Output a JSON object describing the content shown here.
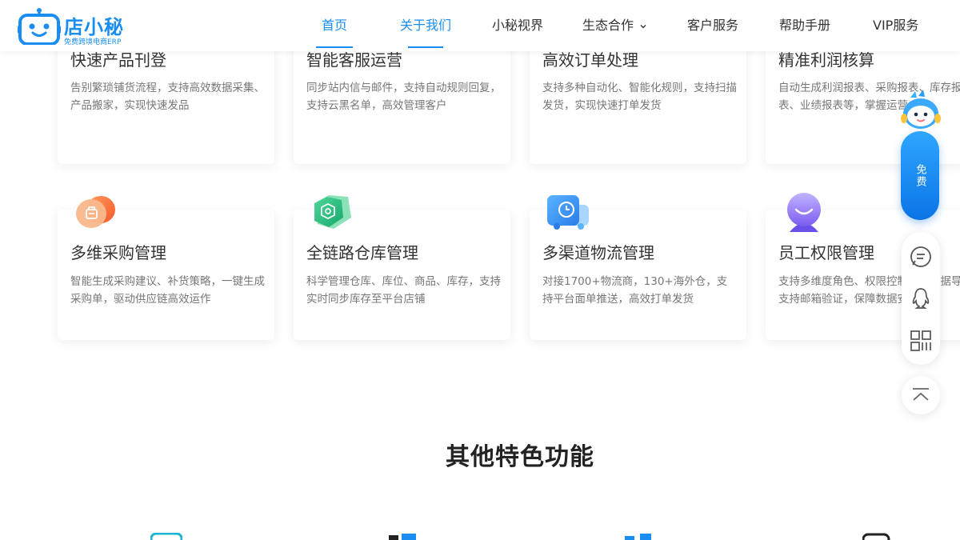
{
  "header": {
    "logo": {
      "name": "店小秘",
      "subtitle": "免费跨境电商ERP"
    },
    "nav": [
      {
        "label": "首页"
      },
      {
        "label": "关于我们"
      },
      {
        "label": "小秘视界"
      },
      {
        "label": "生态合作"
      },
      {
        "label": "客户服务"
      },
      {
        "label": "帮助手册"
      },
      {
        "label": "VIP服务"
      }
    ]
  },
  "features": [
    {
      "title": "快速产品刊登",
      "desc": "告别繁琐铺货流程，支持高效数据采集、产品搬家，实现快速发品"
    },
    {
      "title": "智能客服运营",
      "desc": "同步站内信与邮件，支持自动规则回复，支持云黑名单，高效管理客户"
    },
    {
      "title": "高效订单处理",
      "desc": "支持多种自动化、智能化规则，支持扫描发货，实现快速打单发货"
    },
    {
      "title": "精准利润核算",
      "desc": "自动生成利润报表、采购报表、库存报表、业绩报表等，掌握运营"
    },
    {
      "title": "多维采购管理",
      "desc": "智能生成采购建议、补货策略，一键生成采购单，驱动供应链高效运作"
    },
    {
      "title": "全链路仓库管理",
      "desc": "科学管理仓库、库位、商品、库存，支持实时同步库存至平台店铺"
    },
    {
      "title": "多渠道物流管理",
      "desc": "对接1700+物流商，130+海外仓，支持平台面单推送，高效打单发货"
    },
    {
      "title": "员工权限管理",
      "desc": "支持多维度角色、权限控制，公数据导出支持邮箱验证，保障数据安全"
    }
  ],
  "float_bar": {
    "pill_label": "免费",
    "icons": [
      "chat-icon",
      "qq-icon",
      "qrcode-icon",
      "back-to-top-icon"
    ]
  },
  "section": {
    "title": "其他特色功能"
  },
  "colors": {
    "brand": "#1a8ef0",
    "text": "#333333",
    "muted": "#777777"
  }
}
